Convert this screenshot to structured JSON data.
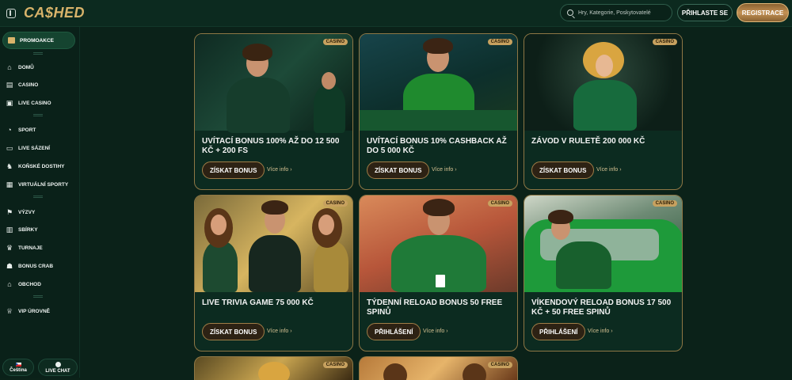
{
  "header": {
    "logo": "CA$HED",
    "search_placeholder": "Hry, Kategorie, Poskytovatelé",
    "login_label": "PŘIHLASTE SE",
    "register_label": "REGISTRACE"
  },
  "sidebar": {
    "promo": "PROMOAKCE",
    "items": [
      {
        "label": "DOMŮ",
        "icon": "home-icon"
      },
      {
        "label": "CASINO",
        "icon": "casino-icon"
      },
      {
        "label": "LIVE CASINO",
        "icon": "live-casino-icon"
      },
      {
        "label": "SPORT",
        "icon": "sport-icon"
      },
      {
        "label": "LIVE SÁZENÍ",
        "icon": "live-betting-icon"
      },
      {
        "label": "KOŇSKÉ DOSTIHY",
        "icon": "horse-icon"
      },
      {
        "label": "VIRTUÁLNÍ SPORTY",
        "icon": "virtual-sports-icon"
      },
      {
        "label": "VÝZVY",
        "icon": "challenge-icon"
      },
      {
        "label": "SBÍRKY",
        "icon": "collections-icon"
      },
      {
        "label": "TURNAJE",
        "icon": "tournament-icon"
      },
      {
        "label": "BONUS CRAB",
        "icon": "crab-icon"
      },
      {
        "label": "OBCHOD",
        "icon": "shop-icon"
      },
      {
        "label": "VIP ÚROVNĚ",
        "icon": "vip-icon"
      }
    ],
    "language": "Čeština",
    "chat": "LIVE CHAT"
  },
  "promotions": [
    {
      "badge": "CASINO",
      "title": "UVÍTACÍ BONUS 100% AŽ DO 12 500 KČ + 200 FS",
      "cta": "ZÍSKAT BONUS",
      "more": "Více info"
    },
    {
      "badge": "CASINO",
      "title": "UVÍTACÍ BONUS 10% CASHBACK AŽ DO 5 000 KČ",
      "cta": "ZÍSKAT BONUS",
      "more": "Více info"
    },
    {
      "badge": "CASINO",
      "title": "ZÁVOD V RULETĚ 200 000 KČ",
      "cta": "ZÍSKAT BONUS",
      "more": "Více info"
    },
    {
      "badge": "CASINO",
      "title": "LIVE TRIVIA GAME 75 000 KČ",
      "cta": "ZÍSKAT BONUS",
      "more": "Více info"
    },
    {
      "badge": "CASINO",
      "title": "TÝDENNÍ RELOAD BONUS 50 FREE SPINŮ",
      "cta": "PŘIHLÁŠENÍ",
      "more": "Více info"
    },
    {
      "badge": "CASINO",
      "title": "VÍKENDOVÝ RELOAD BONUS 17 500 KČ + 50 FREE SPINŮ",
      "cta": "PŘIHLÁŠENÍ",
      "more": "Více info"
    },
    {
      "badge": "CASINO"
    },
    {
      "badge": "CASINO"
    }
  ]
}
